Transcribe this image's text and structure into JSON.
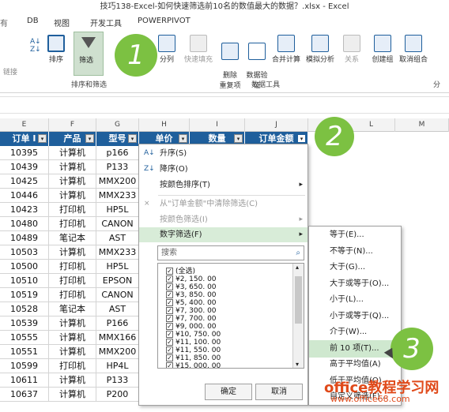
{
  "window": {
    "title": "技巧138-Excel-如何快速筛选前10名的数值最大的数据？.xlsx - Excel"
  },
  "tabs": [
    "DB",
    "视图",
    "开发工具",
    "POWERPIVOT"
  ],
  "ribbon": {
    "buttons": [
      {
        "label": "排序"
      },
      {
        "label": "筛选"
      },
      {
        "label": "分列"
      },
      {
        "label": "快速填充"
      },
      {
        "label": "删除\n重复项"
      },
      {
        "label": "数据验\n证"
      },
      {
        "label": "合并计算"
      },
      {
        "label": "模拟分析"
      },
      {
        "label": "关系"
      },
      {
        "label": "创建组"
      },
      {
        "label": "取消组合"
      },
      {
        "label": "分"
      }
    ],
    "left_label": "链接",
    "groups": [
      "排序和筛选",
      "数据工具"
    ]
  },
  "columns": [
    "E",
    "F",
    "G",
    "H",
    "I",
    "J",
    "L",
    "M"
  ],
  "headers": [
    "订单 I",
    "产品",
    "型号",
    "单价",
    "数量",
    "订单金额"
  ],
  "rows": [
    [
      "10395",
      "计算机",
      "p166"
    ],
    [
      "10439",
      "计算机",
      "P133"
    ],
    [
      "10425",
      "计算机",
      "MMX200"
    ],
    [
      "10446",
      "计算机",
      "MMX233"
    ],
    [
      "10423",
      "打印机",
      "HP5L"
    ],
    [
      "10480",
      "打印机",
      "CANON"
    ],
    [
      "10489",
      "笔记本",
      "AST"
    ],
    [
      "10503",
      "计算机",
      "MMX233"
    ],
    [
      "10500",
      "打印机",
      "HP5L"
    ],
    [
      "10510",
      "打印机",
      "EPSON"
    ],
    [
      "10519",
      "打印机",
      "CANON"
    ],
    [
      "10528",
      "笔记本",
      "AST"
    ],
    [
      "10539",
      "计算机",
      "P166"
    ],
    [
      "10555",
      "计算机",
      "MMX166"
    ],
    [
      "10551",
      "计算机",
      "MMX200"
    ],
    [
      "10599",
      "打印机",
      "HP4L"
    ],
    [
      "10611",
      "计算机",
      "P133"
    ],
    [
      "10637",
      "计算机",
      "P200"
    ]
  ],
  "menu": {
    "items": [
      {
        "label": "升序(S)",
        "icon": "sort-asc-icon"
      },
      {
        "label": "降序(O)",
        "icon": "sort-desc-icon"
      },
      {
        "label": "按颜色排序(T)",
        "arrow": true
      },
      {
        "label": "从\"订单金额\"中清除筛选(C)",
        "disabled": true,
        "icon": "clear-filter-icon"
      },
      {
        "label": "按颜色筛选(I)",
        "disabled": true,
        "arrow": true
      },
      {
        "label": "数字筛选(F)",
        "arrow": true,
        "highlight": true
      }
    ],
    "search_placeholder": "搜索",
    "list": [
      "(全选)",
      "¥2, 150. 00",
      "¥3, 650. 00",
      "¥3, 850. 00",
      "¥5, 400. 00",
      "¥7, 300. 00",
      "¥7, 700. 00",
      "¥9, 000. 00",
      "¥10, 750. 00",
      "¥11, 100. 00",
      "¥11, 550. 00",
      "¥11, 850. 00",
      "¥15, 000. 00"
    ],
    "ok": "确定",
    "cancel": "取消"
  },
  "submenu": {
    "items": [
      "等于(E)...",
      "不等于(N)...",
      "大于(G)...",
      "大于或等于(O)...",
      "小于(L)...",
      "小于或等于(Q)...",
      "介于(W)...",
      "前 10 项(T)...",
      "高于平均值(A)",
      "低于平均值(O)",
      "自定义筛选(F)..."
    ]
  },
  "callouts": [
    "1",
    "2",
    "3"
  ],
  "watermark": {
    "line1": "office教程学习网",
    "line2": "www.office68.com"
  },
  "colors": {
    "header_bg": "#1f5f9c",
    "callout": "#7cc142",
    "highlight": "#d8ecd8"
  }
}
